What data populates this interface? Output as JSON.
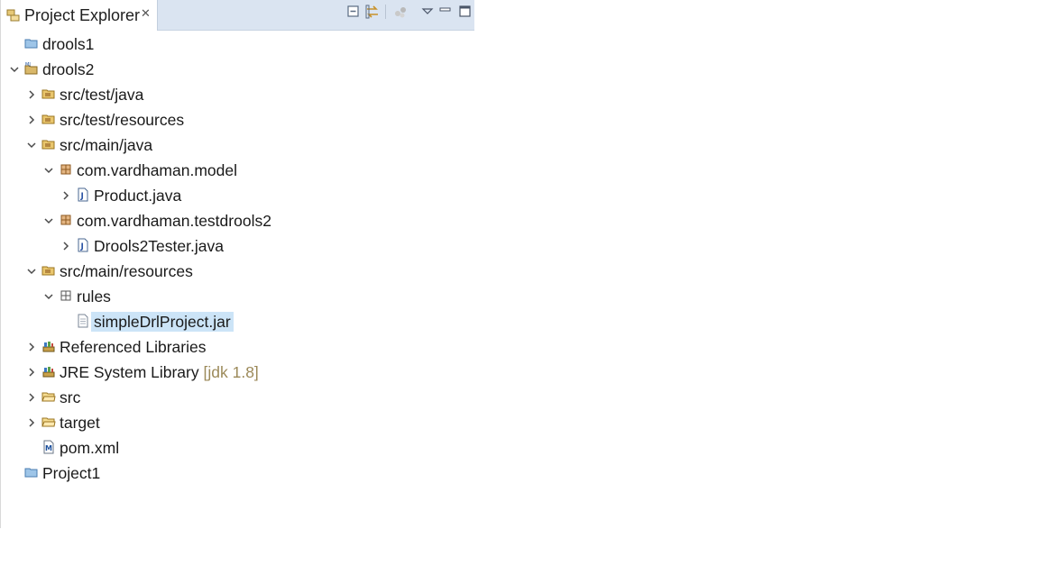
{
  "view": {
    "tab_title": "Project Explorer",
    "tab_close": "✕",
    "toolbar": [
      "collapse-all-icon",
      "link-with-editor-icon",
      "filter-icon",
      "view-menu-icon",
      "minimize-icon",
      "maximize-icon"
    ]
  },
  "tree": [
    {
      "label": "drools1",
      "icon": "closed-project-icon",
      "level": 0,
      "twisty": "none"
    },
    {
      "label": "drools2",
      "icon": "maven-project-icon",
      "level": 0,
      "twisty": "expanded"
    },
    {
      "label": "src/test/java",
      "icon": "source-folder-icon",
      "level": 1,
      "twisty": "collapsed"
    },
    {
      "label": "src/test/resources",
      "icon": "source-folder-icon",
      "level": 1,
      "twisty": "collapsed"
    },
    {
      "label": "src/main/java",
      "icon": "source-folder-icon",
      "level": 1,
      "twisty": "expanded"
    },
    {
      "label": "com.vardhaman.model",
      "icon": "package-icon",
      "level": 2,
      "twisty": "expanded"
    },
    {
      "label": "Product.java",
      "icon": "java-file-icon",
      "level": 3,
      "twisty": "collapsed"
    },
    {
      "label": "com.vardhaman.testdrools2",
      "icon": "package-icon",
      "level": 2,
      "twisty": "expanded"
    },
    {
      "label": "Drools2Tester.java",
      "icon": "java-file-icon",
      "level": 3,
      "twisty": "collapsed"
    },
    {
      "label": "src/main/resources",
      "icon": "source-folder-icon",
      "level": 1,
      "twisty": "expanded"
    },
    {
      "label": "rules",
      "icon": "empty-package-icon",
      "level": 2,
      "twisty": "expanded"
    },
    {
      "label": "simpleDrlProject.jar",
      "icon": "file-icon",
      "level": 3,
      "twisty": "none",
      "selected": true
    },
    {
      "label": "Referenced Libraries",
      "icon": "library-icon",
      "level": 1,
      "twisty": "collapsed"
    },
    {
      "label": "JRE System Library",
      "decoration": "[jdk 1.8]",
      "icon": "library-icon",
      "level": 1,
      "twisty": "collapsed"
    },
    {
      "label": "src",
      "icon": "folder-icon",
      "level": 1,
      "twisty": "collapsed"
    },
    {
      "label": "target",
      "icon": "folder-icon",
      "level": 1,
      "twisty": "collapsed"
    },
    {
      "label": "pom.xml",
      "icon": "maven-pom-icon",
      "level": 1,
      "twisty": "none"
    },
    {
      "label": "Project1",
      "icon": "closed-project-icon",
      "level": 0,
      "twisty": "none"
    }
  ],
  "colors": {
    "tabbar_bg": "#dae4f1",
    "selection": "#cce4f7",
    "decoration_text": "#9c8a5a"
  }
}
